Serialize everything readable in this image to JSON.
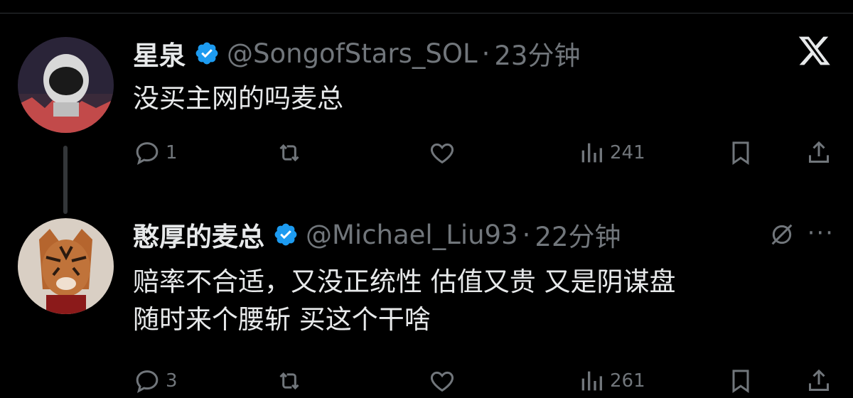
{
  "tweets": [
    {
      "name": "星泉",
      "handle": "@SongofStars_SOL",
      "separator": "·",
      "time": "23分钟",
      "text": [
        "没买主网的吗麦总"
      ],
      "replies": "1",
      "retweets": "",
      "likes": "",
      "views": "241"
    },
    {
      "name": "憨厚的麦总",
      "handle": "@Michael_Liu93",
      "separator": "·",
      "time": "22分钟",
      "text": [
        "赔率不合适，又没正统性 估值又贵 又是阴谋盘",
        "随时来个腰斩 买这个干啥"
      ],
      "replies": "3",
      "retweets": "",
      "likes": "",
      "views": "261"
    }
  ],
  "more_label": "···",
  "colors": {
    "background": "#000000",
    "text": "#e7e9ea",
    "muted": "#71767b",
    "verified": "#1d9bf0"
  }
}
